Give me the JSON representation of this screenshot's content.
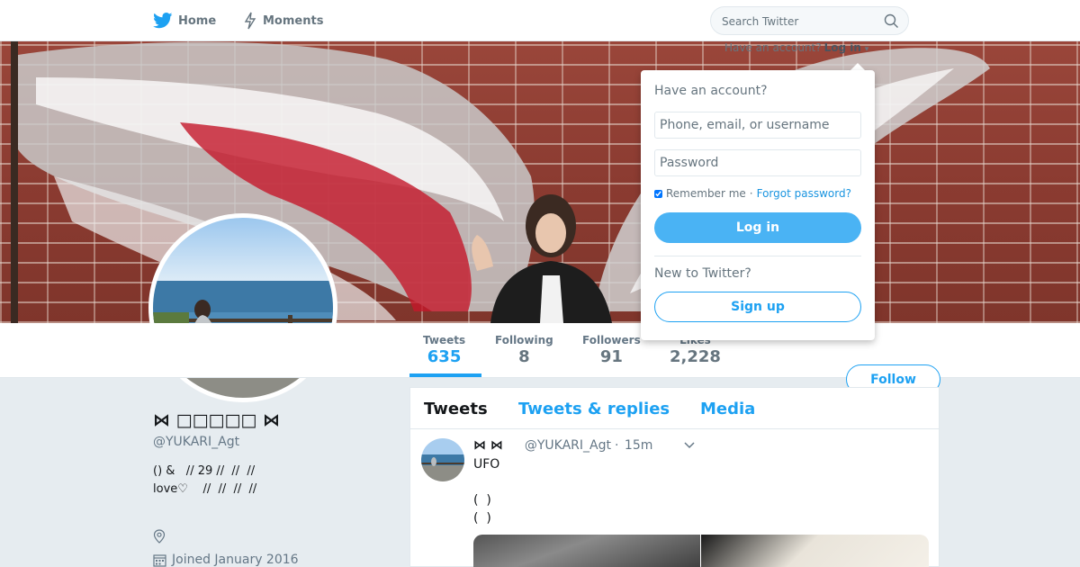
{
  "nav": {
    "home_label": "Home",
    "moments_label": "Moments",
    "search_placeholder": "Search Twitter",
    "login_prompt": "Have an account?",
    "login_link": "Log in"
  },
  "colors": {
    "accent": "#1da1f2",
    "login_button": "#4ab3f4"
  },
  "profile": {
    "name": "⋈ □□□□□ ⋈",
    "handle": "@YUKARI_Agt",
    "bio": "() &   // 29 //  //  //\nlove♡    //  //  //  //",
    "joined": "Joined January 2016"
  },
  "stats": [
    {
      "label": "Tweets",
      "value": "635"
    },
    {
      "label": "Following",
      "value": "8"
    },
    {
      "label": "Followers",
      "value": "91"
    },
    {
      "label": "Likes",
      "value": "2,228"
    }
  ],
  "follow_label": "Follow",
  "timeline": {
    "tabs": [
      "Tweets",
      "Tweets & replies",
      "Media"
    ],
    "tweet": {
      "name": "⋈  ⋈",
      "handle": "@YUKARI_Agt",
      "dot": "·",
      "time": "15m",
      "text": "UFO\n\n(  )\n(  )"
    }
  },
  "login_dropdown": {
    "title": "Have an account?",
    "username_placeholder": "Phone, email, or username",
    "password_placeholder": "Password",
    "remember_label": "Remember me",
    "separator": "·",
    "forgot_label": "Forgot password?",
    "login_button": "Log in",
    "new_prompt": "New to Twitter?",
    "signup_button": "Sign up"
  },
  "icons": [
    "twitter-bird-icon",
    "bolt-icon",
    "search-icon",
    "location-icon",
    "calendar-icon",
    "chevron-down-icon"
  ]
}
